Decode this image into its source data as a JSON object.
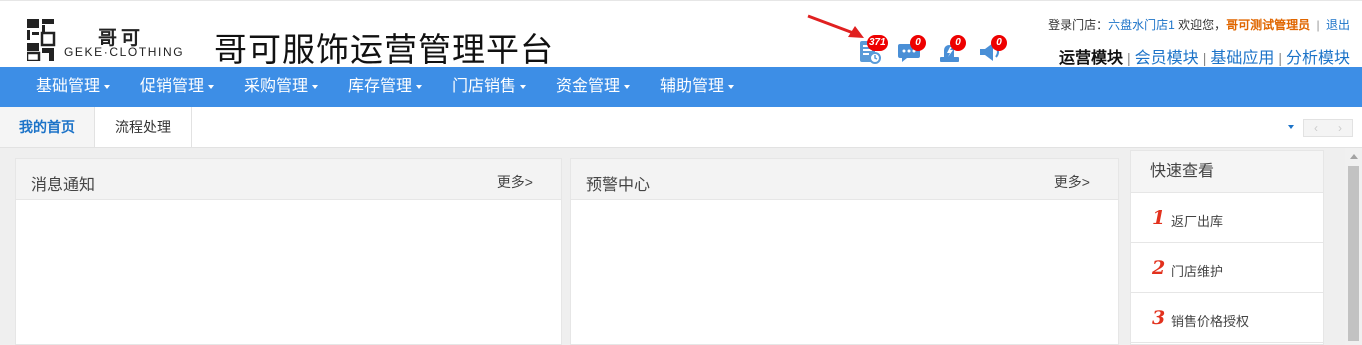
{
  "header": {
    "logo_cn": "哥可",
    "logo_en": "GEKE·CLOTHING",
    "platform_title": "哥可服饰运营管理平台",
    "notices": [
      {
        "icon": "task-list-icon",
        "count": "371"
      },
      {
        "icon": "message-chat-icon",
        "count": "0"
      },
      {
        "icon": "alert-hand-icon",
        "count": "0"
      },
      {
        "icon": "broadcast-speaker-icon",
        "count": "0"
      }
    ],
    "login": {
      "store_label": "登录门店：",
      "store_name": "六盘水门店1",
      "welcome": "欢迎您，",
      "user": "哥可测试管理员",
      "separator": "|",
      "logout": "退出"
    },
    "modules": [
      "运营模块",
      "会员模块",
      "基础应用",
      "分析模块"
    ],
    "active_module": "运营模块"
  },
  "nav": {
    "items": [
      "基础管理",
      "促销管理",
      "采购管理",
      "库存管理",
      "门店销售",
      "资金管理",
      "辅助管理"
    ]
  },
  "tabs": {
    "items": [
      "我的首页",
      "流程处理"
    ],
    "active": "我的首页",
    "scroll_prev": "‹",
    "scroll_next": "›"
  },
  "panels": {
    "messages": {
      "title": "消息通知",
      "more": "更多>"
    },
    "warnings": {
      "title": "预警中心",
      "more": "更多>"
    }
  },
  "quick_view": {
    "title": "快速查看",
    "items": [
      {
        "num": "1",
        "label": "返厂出库"
      },
      {
        "num": "2",
        "label": "门店维护"
      },
      {
        "num": "3",
        "label": "销售价格授权"
      }
    ]
  },
  "colors": {
    "nav_bg": "#3d8ee6",
    "link": "#1c73c8",
    "badge": "#ee0000",
    "admin_name": "#e06600",
    "quick_num": "#e2311d"
  }
}
